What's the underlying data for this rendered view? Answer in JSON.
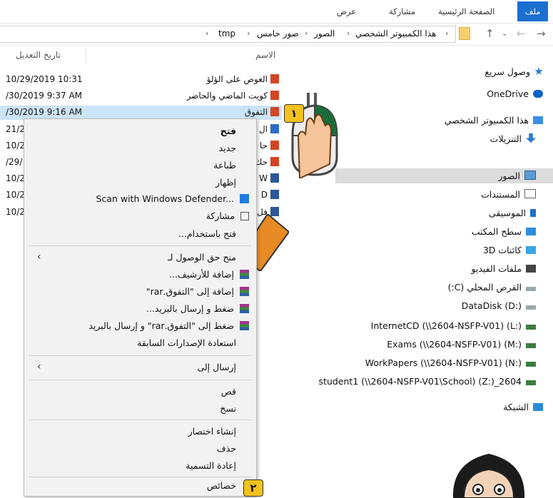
{
  "ribbon": {
    "tabs": [
      "ملف",
      "الصفحة الرئيسية",
      "مشاركة",
      "عرض"
    ]
  },
  "address": {
    "breadcrumb": [
      "هذا الكمبيوتر الشخصي",
      "الصور",
      "صور خامس",
      "tmp"
    ]
  },
  "columns": {
    "name": "الاسم",
    "date": "تاريخ التعديل"
  },
  "files": [
    {
      "name": "الغوص على الؤلؤ",
      "date": "10/29/2019 10:31"
    },
    {
      "name": "كويت الماضي والحاضر",
      "date": "/30/2019 9:37 AM"
    },
    {
      "name": "التفوق",
      "date": "/30/2019 9:16 AM"
    },
    {
      "name": "ال",
      "date": "21/2"
    },
    {
      "name": "حا",
      "date": "10/2"
    },
    {
      "name": "حك",
      "date": "/29/"
    },
    {
      "name": "W",
      "date": "10/2"
    },
    {
      "name": "D",
      "date": "10/2"
    },
    {
      "name": "فل",
      "date": "10/2"
    }
  ],
  "nav": {
    "items": [
      {
        "label": "وصول سريع",
        "icon": "star-icon"
      },
      {
        "label": "OneDrive",
        "icon": "cloud-icon"
      },
      {
        "label": "هذا الكمبيوتر الشخصي",
        "icon": "computer-icon"
      },
      {
        "label": "التنزيلات",
        "icon": "download-arrow-icon"
      },
      {
        "label": "الصور",
        "icon": "pictures-icon"
      },
      {
        "label": "المستندات",
        "icon": "documents-icon"
      },
      {
        "label": "الموسيقى",
        "icon": "music-icon"
      },
      {
        "label": "سطح المكتب",
        "icon": "desktop-icon"
      },
      {
        "label": "كائنات 3D",
        "icon": "cube-icon"
      },
      {
        "label": "ملفات الفيديو",
        "icon": "video-icon"
      },
      {
        "label": "القرص المحلي (C:)",
        "icon": "drive-icon"
      },
      {
        "label": "DataDisk (D:)",
        "icon": "drive-icon"
      },
      {
        "label": "InternetCD (\\\\2604-NSFP-V01) (L:)",
        "icon": "network-drive-icon"
      },
      {
        "label": "Exams (\\\\2604-NSFP-V01) (M:)",
        "icon": "network-drive-icon"
      },
      {
        "label": "WorkPapers (\\\\2604-NSFP-V01) (N:)",
        "icon": "network-drive-icon"
      },
      {
        "label": "student1 (\\\\2604-NSFP-V01\\School) (Z:)_2604",
        "icon": "network-drive-icon"
      },
      {
        "label": "الشبكة",
        "icon": "network-icon"
      }
    ]
  },
  "context_menu": {
    "items": [
      {
        "label": "فتح"
      },
      {
        "label": "جديد"
      },
      {
        "label": "طباعة"
      },
      {
        "label": "إظهار"
      },
      {
        "label": "Scan with Windows Defender..."
      },
      {
        "label": "مشاركة"
      },
      {
        "label": "فتح باستخدام..."
      },
      {
        "label": "منح حق الوصول لـ"
      },
      {
        "label": "إضافة للأرشيف..."
      },
      {
        "label": "إضافة إلى \"التفوق.rar\""
      },
      {
        "label": "ضغط و إرسال بالبريد..."
      },
      {
        "label": "ضغط إلى \"التفوق.rar\" و إرسال بالبريد"
      },
      {
        "label": "استعادة الإصدارات السابقة"
      },
      {
        "label": "إرسال إلى"
      },
      {
        "label": "قص"
      },
      {
        "label": "نسخ"
      },
      {
        "label": "إنشاء اختصار"
      },
      {
        "label": "حذف"
      },
      {
        "label": "إعادة التسمية"
      },
      {
        "label": "خصائص"
      }
    ]
  },
  "badges": {
    "one": "١",
    "two": "٢"
  },
  "colors": {
    "accent": "#1a6fd1",
    "selection": "#cce4f7",
    "badge": "#f4c21d"
  }
}
